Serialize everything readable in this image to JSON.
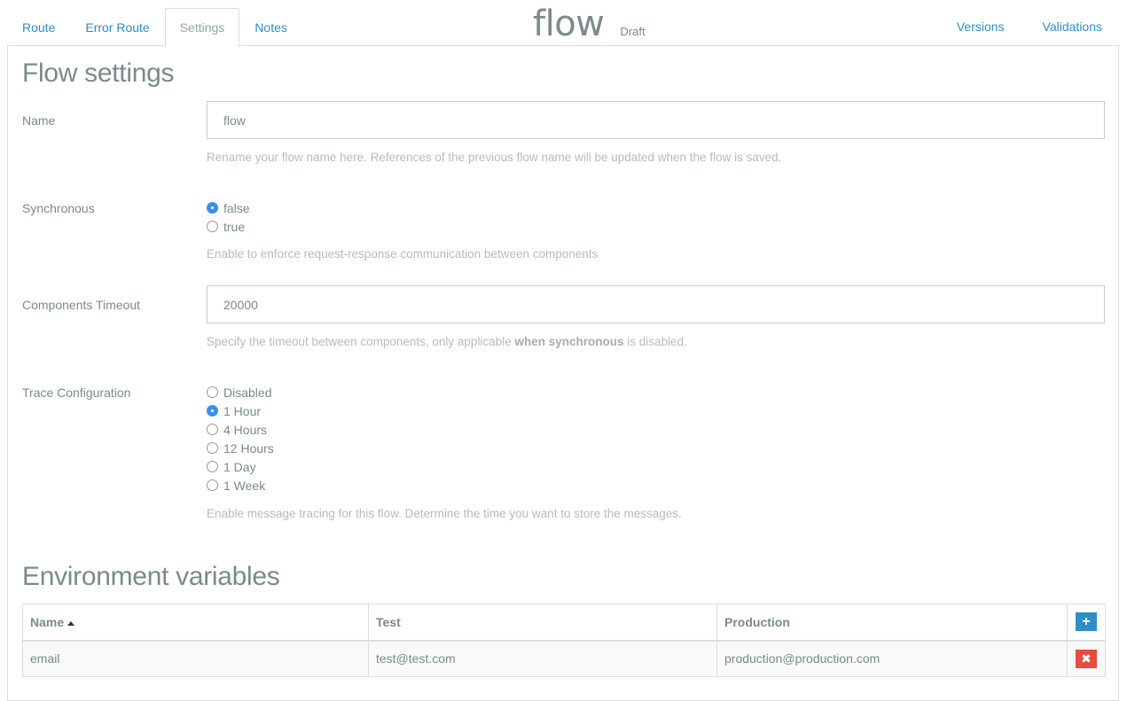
{
  "tabs": [
    {
      "label": "Route",
      "active": false
    },
    {
      "label": "Error Route",
      "active": false
    },
    {
      "label": "Settings",
      "active": true
    },
    {
      "label": "Notes",
      "active": false
    }
  ],
  "header": {
    "flow_name": "flow",
    "status": "Draft",
    "links": [
      "Versions",
      "Validations"
    ]
  },
  "settings": {
    "heading": "Flow settings",
    "name": {
      "label": "Name",
      "value": "flow",
      "help": "Rename your flow name here. References of the previous flow name will be updated when the flow is saved."
    },
    "synchronous": {
      "label": "Synchronous",
      "options": [
        "false",
        "true"
      ],
      "selected": "false",
      "help": "Enable to enforce request-response communication between components"
    },
    "timeout": {
      "label": "Components Timeout",
      "value": "20000",
      "help_prefix": "Specify the timeout between components, only applicable ",
      "help_bold": "when synchronous",
      "help_suffix": " is disabled."
    },
    "trace": {
      "label": "Trace Configuration",
      "options": [
        "Disabled",
        "1 Hour",
        "4 Hours",
        "12 Hours",
        "1 Day",
        "1 Week"
      ],
      "selected": "1 Hour",
      "help": "Enable message tracing for this flow. Determine the time you want to store the messages."
    }
  },
  "env": {
    "heading": "Environment variables",
    "columns": [
      "Name",
      "Test",
      "Production"
    ],
    "sort_column": "Name",
    "sort_direction": "ascending",
    "add_icon": "plus-icon",
    "delete_icon": "times-icon",
    "rows": [
      {
        "name": "email",
        "test": "test@test.com",
        "production": "production@production.com"
      }
    ],
    "colors": {
      "add": "#2c8fc7",
      "delete": "#e74c3c"
    }
  }
}
